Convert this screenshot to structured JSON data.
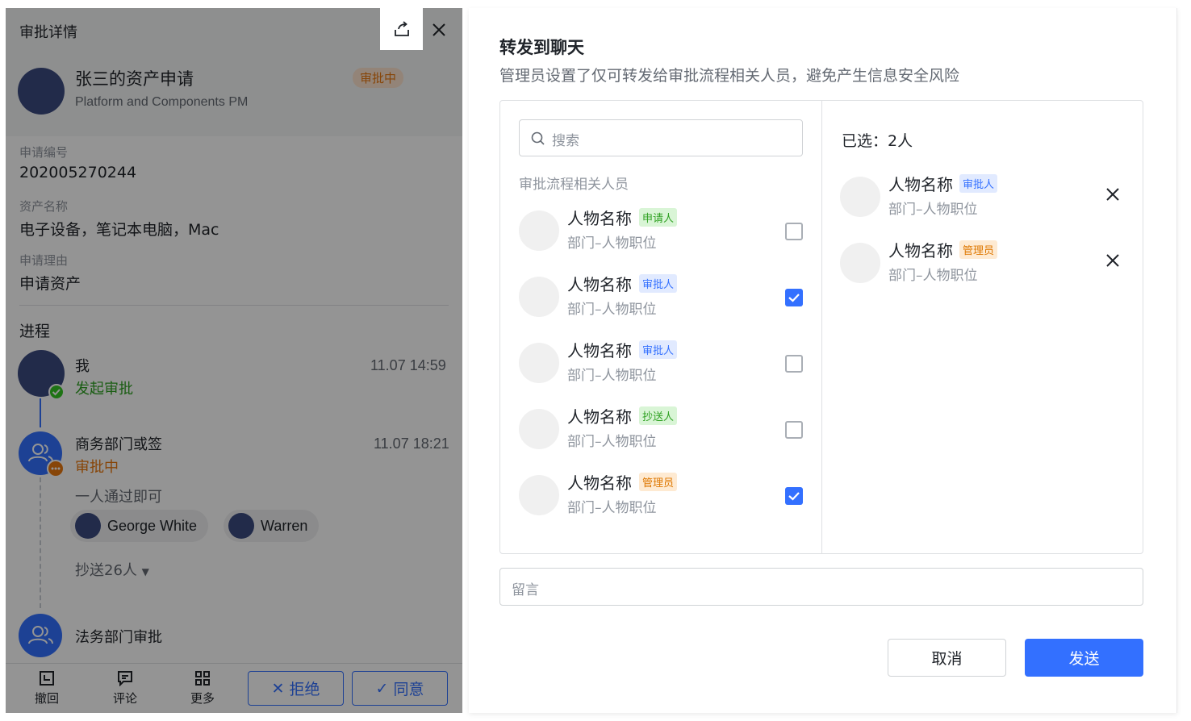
{
  "detail": {
    "title": "审批详情",
    "applicant_title": "张三的资产申请",
    "applicant_sub": "Platform and Components PM",
    "status_badge": "审批中",
    "fields": [
      {
        "label": "申请编号",
        "value": "202005270244"
      },
      {
        "label": "资产名称",
        "value": "电子设备，笔记本电脑，Mac"
      },
      {
        "label": "申请理由",
        "value": "申请资产"
      }
    ],
    "progress_title": "进程",
    "steps": [
      {
        "name": "我",
        "state": "发起审批",
        "time": "11.07 14:59"
      },
      {
        "name": "商务部门或签",
        "state": "审批中",
        "time": "11.07 18:21",
        "rule": "一人通过即可",
        "approvers": [
          "George White",
          "Warren"
        ],
        "cc": "抄送26人"
      },
      {
        "name": "法务部门审批"
      }
    ],
    "toolbar": {
      "withdraw": "撤回",
      "comment": "评论",
      "more": "更多",
      "reject": "拒绝",
      "agree": "同意"
    }
  },
  "modal": {
    "title": "转发到聊天",
    "description": "管理员设置了仅可转发给审批流程相关人员，避免产生信息安全风险",
    "search_placeholder": "搜索",
    "group_label": "审批流程相关人员",
    "people": [
      {
        "name": "人物名称",
        "tag": "申请人",
        "tag_color": "green",
        "dept": "部门–人物职位",
        "checked": false
      },
      {
        "name": "人物名称",
        "tag": "审批人",
        "tag_color": "blue",
        "dept": "部门–人物职位",
        "checked": true
      },
      {
        "name": "人物名称",
        "tag": "审批人",
        "tag_color": "blue",
        "dept": "部门–人物职位",
        "checked": false
      },
      {
        "name": "人物名称",
        "tag": "抄送人",
        "tag_color": "green",
        "dept": "部门–人物职位",
        "checked": false
      },
      {
        "name": "人物名称",
        "tag": "管理员",
        "tag_color": "orange",
        "dept": "部门–人物职位",
        "checked": true
      }
    ],
    "selected_title": "已选：2人",
    "selected": [
      {
        "name": "人物名称",
        "tag": "审批人",
        "tag_color": "blue",
        "dept": "部门–人物职位"
      },
      {
        "name": "人物名称",
        "tag": "管理员",
        "tag_color": "orange",
        "dept": "部门–人物职位"
      }
    ],
    "note_placeholder": "留言",
    "cancel": "取消",
    "send": "发送"
  },
  "colors": {
    "primary": "#3370ff",
    "success": "#2ea121",
    "warning": "#e8780f",
    "overlay": "rgba(0,0,0,0.42)"
  }
}
